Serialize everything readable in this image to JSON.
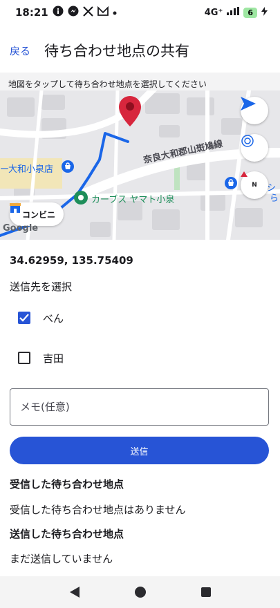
{
  "status_bar": {
    "time": "18:21",
    "network": "4G⁺",
    "battery": "6"
  },
  "app_bar": {
    "back_label": "戻る",
    "title": "待ち合わせ地点の共有"
  },
  "hint": "地図をタップして待ち合わせ地点を選択してください",
  "map": {
    "road_label": "奈良大和郡山斑鳩線",
    "store_label": "大和小泉店",
    "store_prefix": "ー",
    "place_label": "カーブス ヤマト小泉",
    "compass_label": "N",
    "partial_label_1": "シ",
    "partial_label_2": "ら",
    "google_logo": "Google",
    "poi_chip": "コンビニ"
  },
  "coordinates": "34.62959, 135.75409",
  "recipient": {
    "label": "送信先を選択",
    "options": [
      {
        "name": "べん",
        "checked": true
      },
      {
        "name": "吉田",
        "checked": false
      }
    ]
  },
  "memo": {
    "placeholder": "メモ(任意)",
    "value": ""
  },
  "send_label": "送信",
  "received": {
    "title": "受信した待ち合わせ地点",
    "empty": "受信した待ち合わせ地点はありません"
  },
  "sent": {
    "title": "送信した待ち合わせ地点",
    "empty": "まだ送信していません"
  },
  "colors": {
    "accent": "#2754d6",
    "marker": "#d7263d",
    "route": "#1a66e8"
  }
}
